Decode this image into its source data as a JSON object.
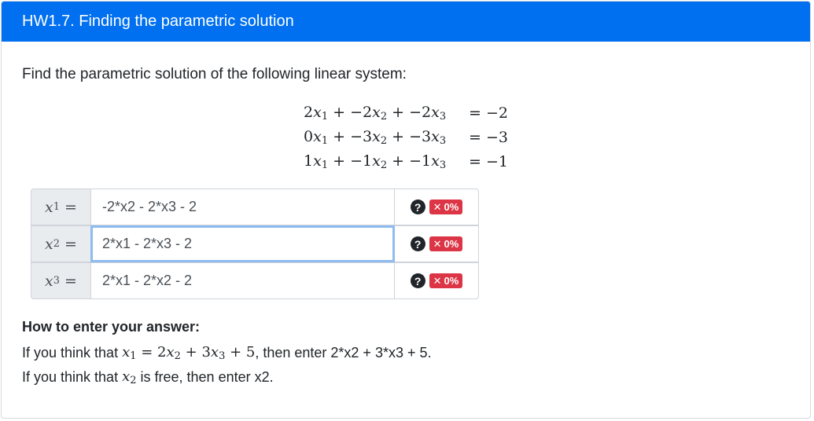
{
  "header": {
    "title": "HW1.7. Finding the parametric solution"
  },
  "prompt": "Find the parametric solution of the following linear system:",
  "system": {
    "rows": [
      {
        "lhs": [
          {
            "coef": "2",
            "var": "x",
            "sub": "1"
          },
          {
            "op": "+",
            "coef": "−2",
            "var": "x",
            "sub": "2"
          },
          {
            "op": "+",
            "coef": "−2",
            "var": "x",
            "sub": "3"
          }
        ],
        "rhs": "−2"
      },
      {
        "lhs": [
          {
            "coef": "0",
            "var": "x",
            "sub": "1"
          },
          {
            "op": "+",
            "coef": "−3",
            "var": "x",
            "sub": "2"
          },
          {
            "op": "+",
            "coef": "−3",
            "var": "x",
            "sub": "3"
          }
        ],
        "rhs": "−3"
      },
      {
        "lhs": [
          {
            "coef": "1",
            "var": "x",
            "sub": "1"
          },
          {
            "op": "+",
            "coef": "−1",
            "var": "x",
            "sub": "2"
          },
          {
            "op": "+",
            "coef": "−1",
            "var": "x",
            "sub": "3"
          }
        ],
        "rhs": "−1"
      }
    ]
  },
  "answers": [
    {
      "var": "x",
      "sub": "1",
      "value": "-2*x2 - 2*x3 - 2",
      "focused": false,
      "badge": "0%",
      "icon_help": "question-circle-icon",
      "icon_status": "x-icon"
    },
    {
      "var": "x",
      "sub": "2",
      "value": "2*x1 - 2*x3 - 2",
      "focused": true,
      "badge": "0%",
      "icon_help": "question-circle-icon",
      "icon_status": "x-icon"
    },
    {
      "var": "x",
      "sub": "3",
      "value": "2*x1 - 2*x2 - 2",
      "focused": false,
      "badge": "0%",
      "icon_help": "question-circle-icon",
      "icon_status": "x-icon"
    }
  ],
  "howto": {
    "title": "How to enter your answer:",
    "line1_prefix": "If you think that ",
    "line1_suffix": ", then enter 2*x2 + 3*x3 + 5.",
    "line2_prefix": "If you think that ",
    "line2_suffix": " is free, then enter x2."
  },
  "colors": {
    "header_bg": "#0070f0",
    "badge_bg": "#dc3545",
    "focus_border": "#8ebcf0"
  }
}
